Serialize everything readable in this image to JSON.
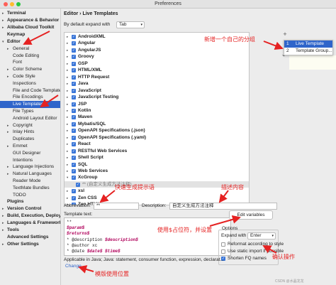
{
  "window": {
    "title": "Preferences"
  },
  "sidebar": {
    "items": [
      {
        "label": "Terminal",
        "arrow": "▸"
      },
      {
        "label": "Appearance & Behavior",
        "arrow": "▸"
      },
      {
        "label": "Alibaba Cloud Toolkit",
        "arrow": "▸"
      },
      {
        "label": "Keymap",
        "arrow": ""
      },
      {
        "label": "Editor",
        "arrow": "▾"
      },
      {
        "label": "General",
        "arrow": "▸"
      },
      {
        "label": "Code Editing",
        "arrow": ""
      },
      {
        "label": "Font",
        "arrow": ""
      },
      {
        "label": "Color Scheme",
        "arrow": "▸"
      },
      {
        "label": "Code Style",
        "arrow": "▸"
      },
      {
        "label": "Inspections",
        "arrow": ""
      },
      {
        "label": "File and Code Templates",
        "arrow": ""
      },
      {
        "label": "File Encodings",
        "arrow": ""
      },
      {
        "label": "Live Templates",
        "arrow": ""
      },
      {
        "label": "File Types",
        "arrow": ""
      },
      {
        "label": "Android Layout Editor",
        "arrow": ""
      },
      {
        "label": "Copyright",
        "arrow": "▸"
      },
      {
        "label": "Inlay Hints",
        "arrow": "▸"
      },
      {
        "label": "Duplicates",
        "arrow": ""
      },
      {
        "label": "Emmet",
        "arrow": "▸"
      },
      {
        "label": "GUI Designer",
        "arrow": ""
      },
      {
        "label": "Intentions",
        "arrow": ""
      },
      {
        "label": "Language Injections",
        "arrow": "▸"
      },
      {
        "label": "Natural Languages",
        "arrow": "▸"
      },
      {
        "label": "Reader Mode",
        "arrow": ""
      },
      {
        "label": "TextMate Bundles",
        "arrow": ""
      },
      {
        "label": "TODO",
        "arrow": ""
      },
      {
        "label": "Plugins",
        "arrow": ""
      },
      {
        "label": "Version Control",
        "arrow": "▸"
      },
      {
        "label": "Build, Execution, Deployment",
        "arrow": "▸"
      },
      {
        "label": "Languages & Frameworks",
        "arrow": "▸"
      },
      {
        "label": "Tools",
        "arrow": "▸"
      },
      {
        "label": "Advanced Settings",
        "arrow": ""
      },
      {
        "label": "Other Settings",
        "arrow": "▸"
      }
    ]
  },
  "main": {
    "breadcrumb": "Editor  ›  Live Templates",
    "expand_label": "By default expand with",
    "expand_value": "Tab",
    "templates": [
      {
        "label": "AndroidXML"
      },
      {
        "label": "Angular"
      },
      {
        "label": "AngularJS"
      },
      {
        "label": "Groovy"
      },
      {
        "label": "GSP"
      },
      {
        "label": "HTML/XML"
      },
      {
        "label": "HTTP Request"
      },
      {
        "label": "Java"
      },
      {
        "label": "JavaScript"
      },
      {
        "label": "JavaScript Testing"
      },
      {
        "label": "JSP"
      },
      {
        "label": "Kotlin"
      },
      {
        "label": "Maven"
      },
      {
        "label": "Mybatis/SQL"
      },
      {
        "label": "OpenAPI Specifications (.json)"
      },
      {
        "label": "OpenAPI Specifications (.yaml)"
      },
      {
        "label": "React"
      },
      {
        "label": "RESTful Web Services"
      },
      {
        "label": "Shell Script"
      },
      {
        "label": "SQL"
      },
      {
        "label": "Web Services"
      },
      {
        "label": "XcGroup"
      },
      {
        "label": "** (自定义生成方法注释)"
      },
      {
        "label": "xsl"
      },
      {
        "label": "Zen CSS"
      },
      {
        "label": "Zen HTML"
      },
      {
        "label": "Zen XSL"
      }
    ],
    "abbreviation_label": "Abbreviation:",
    "abbreviation_value": "**",
    "description_label": "Description:",
    "description_value": "自定义生成方法注释",
    "template_text_label": "Template text:",
    "template_lines": [
      {
        "pre": "**",
        "var": "",
        "post": ""
      },
      {
        "pre": "",
        "var": "$param$",
        "post": ""
      },
      {
        "pre": "",
        "var": "$returns$",
        "post": ""
      },
      {
        "pre": " * @description ",
        "var": "$description$",
        "post": ""
      },
      {
        "pre": " * @author xc",
        "var": "",
        "post": ""
      },
      {
        "pre": " * @date ",
        "var": "$date$ $time$",
        "post": ""
      }
    ],
    "edit_variables": "Edit variables",
    "options": {
      "legend": "Options",
      "expand_with_label": "Expand with",
      "expand_with_value": "Enter",
      "checkboxes": [
        {
          "label": "Reformat according to style",
          "checked": false
        },
        {
          "label": "Use static import if possible",
          "checked": false
        },
        {
          "label": "Shorten FQ names",
          "checked": true
        }
      ]
    },
    "applicable_text": "Applicable in Java; Java: statement, consumer function, expression, declarat...",
    "change_link": "Change"
  },
  "popup": {
    "items": [
      {
        "num": "1",
        "label": "Live Template"
      },
      {
        "num": "2",
        "label": "Template Group..."
      }
    ]
  },
  "toolbar": {
    "add": "+",
    "undo": "↶"
  },
  "annotations": {
    "new_group": "新增一个自己的分组",
    "shortcut": "快速生成提示语",
    "describe": "描述内容",
    "params": "使用$占位符，并设置",
    "confirm": "确认操作",
    "position": "模版使用位置"
  },
  "watermark": "CSDN @水晶龙龙",
  "colors": {
    "accent": "#2f65ca",
    "annotation": "#e52222",
    "template_var": "#b0005a"
  }
}
